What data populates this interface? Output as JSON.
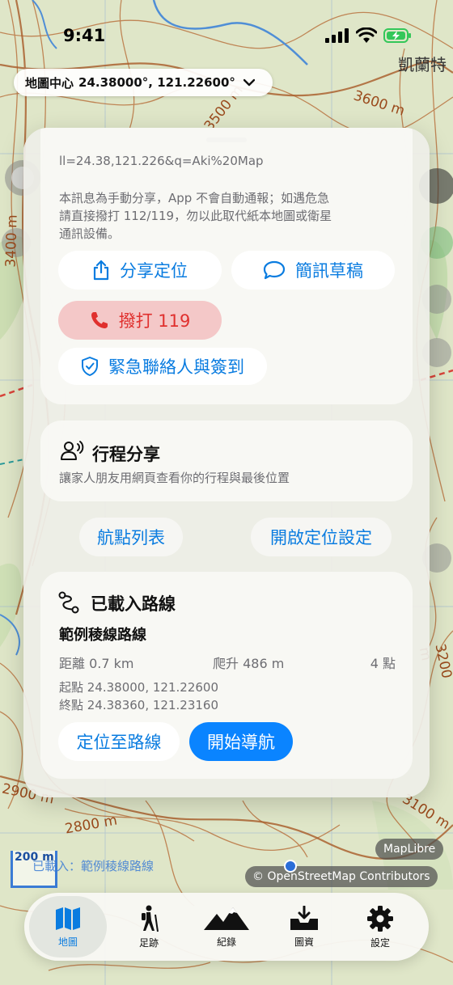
{
  "status_bar": {
    "time": "9:41"
  },
  "map": {
    "center_prefix": "地圖中心",
    "center_coords": "24.38000°, 121.22600°",
    "place_label": "凱蘭特",
    "contour_labels": [
      "3600 m",
      "3500 m",
      "3200 m",
      "2900 m",
      "2800 m",
      "3100 m",
      "3400 m"
    ],
    "scale_label": "200 m",
    "loaded_banner": "已載入：範例稜線路線",
    "maplibre": "MapLibre",
    "osm_attribution": "© OpenStreetMap Contributors"
  },
  "sos": {
    "url_text": "ll=24.38,121.226&q=Aki%20Map",
    "note_line1": "本訊息為手動分享，App 不會自動通報；如遇危急",
    "note_line2": "請直接撥打 112/119，勿以此取代紙本地圖或衛星",
    "note_line3": "通訊設備。",
    "share_location": "分享定位",
    "sms_draft": "簡訊草稿",
    "call_119": "撥打 119",
    "emergency_contacts": "緊急聯絡人與簽到"
  },
  "trip_share": {
    "title": "行程分享",
    "subtitle": "讓家人朋友用網頁查看你的行程與最後位置"
  },
  "actions": {
    "waypoints": "航點列表",
    "location_settings": "開啟定位設定"
  },
  "route": {
    "header": "已載入路線",
    "name": "範例稜線路線",
    "distance": "距離 0.7 km",
    "ascent": "爬升 486 m",
    "points": "4 點",
    "start": "起點 24.38000, 121.22600",
    "end": "終點 24.38360, 121.23160",
    "locate_route": "定位至路線",
    "start_nav": "開始導航"
  },
  "tabs": [
    {
      "label": "地圖",
      "icon": "map-icon",
      "active": true
    },
    {
      "label": "足跡",
      "icon": "hiker-icon",
      "active": false
    },
    {
      "label": "紀錄",
      "icon": "mountains-icon",
      "active": false
    },
    {
      "label": "圖資",
      "icon": "download-tray-icon",
      "active": false
    },
    {
      "label": "設定",
      "icon": "gear-icon",
      "active": false
    }
  ],
  "colors": {
    "accent": "#0a84ff",
    "danger": "#e0302e",
    "contour": "#b5652f",
    "trail_red": "#d8443a",
    "river": "#4f8ed6"
  }
}
